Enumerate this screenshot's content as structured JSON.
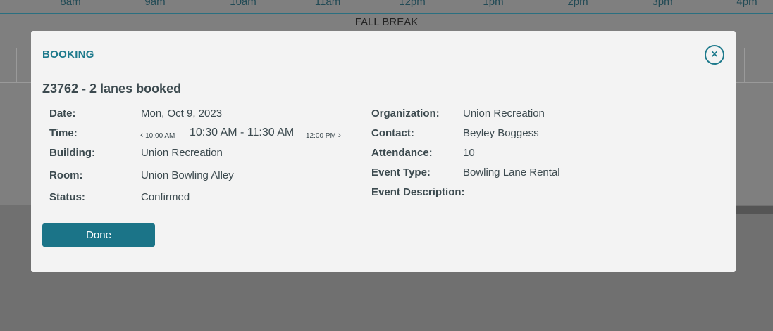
{
  "calendar": {
    "hours": [
      "8am",
      "9am",
      "10am",
      "11am",
      "12pm",
      "1pm",
      "2pm",
      "3pm",
      "4pm"
    ],
    "break_label": "FALL BREAK"
  },
  "modal": {
    "header": "BOOKING",
    "close_icon": "×",
    "title": "Z3762 - 2 lanes booked",
    "left": {
      "date_label": "Date:",
      "date_value": "Mon, Oct 9, 2023",
      "time_label": "Time:",
      "time_prev": "10:00 AM",
      "time_value": "10:30 AM - 11:30 AM",
      "time_next": "12:00 PM",
      "building_label": "Building:",
      "building_value": "Union Recreation",
      "room_label": "Room:",
      "room_value": "Union Bowling Alley",
      "status_label": "Status:",
      "status_value": "Confirmed"
    },
    "right": {
      "organization_label": "Organization:",
      "organization_value": "Union Recreation",
      "contact_label": "Contact:",
      "contact_value": "Beyley Boggess",
      "attendance_label": "Attendance:",
      "attendance_value": "10",
      "event_type_label": "Event Type:",
      "event_type_value": "Bowling Lane Rental",
      "event_description_label": "Event Description:"
    },
    "done_label": "Done"
  },
  "colors": {
    "accent": "#1e7a8c",
    "button": "#1b7488",
    "text": "#3c4a4f",
    "overlay": "#7f7f7f"
  }
}
